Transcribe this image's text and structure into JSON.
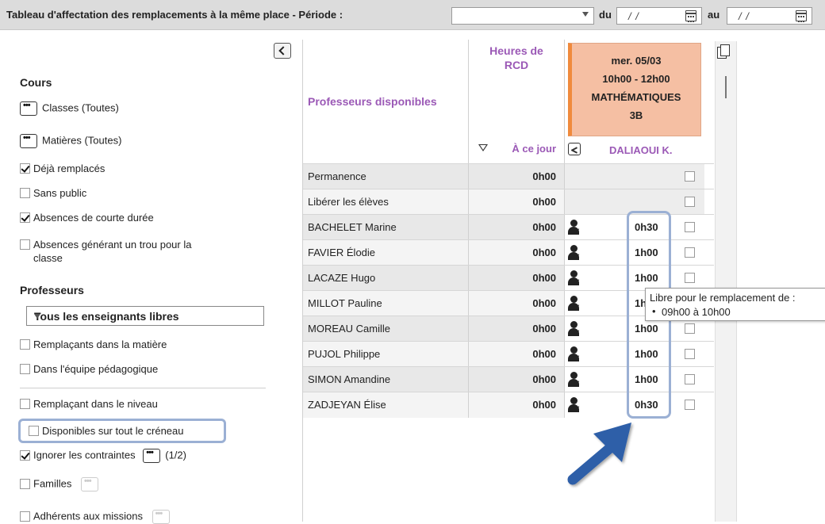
{
  "header": {
    "title": "Tableau d'affectation des remplacements à la même place  -  Période :",
    "period_value": "",
    "du_label": "du",
    "au_label": "au",
    "date_from": "/ /",
    "date_to": "/ /"
  },
  "filters": {
    "cours_title": "Cours",
    "classes_label": "Classes (Toutes)",
    "matieres_label": "Matières (Toutes)",
    "options": [
      {
        "label": "Déjà remplacés",
        "checked": true
      },
      {
        "label": "Sans public",
        "checked": false
      },
      {
        "label": "Absences de courte durée",
        "checked": true
      },
      {
        "label": "Absences générant un trou pour la",
        "label2": "classe",
        "checked": false
      }
    ],
    "professeurs_title": "Professeurs",
    "prof_select": "Tous les enseignants libres",
    "prof_options": [
      {
        "label": "Remplaçants dans la matière",
        "checked": false
      },
      {
        "label": "Dans l'équipe pédagogique",
        "checked": false
      },
      {
        "label": "Remplaçant dans le niveau",
        "checked": false
      },
      {
        "label": "Disponibles sur tout le créneau",
        "checked": false
      },
      {
        "label": "Ignorer les contraintes",
        "checked": true,
        "count": "(1/2)"
      },
      {
        "label": "Familles",
        "checked": false
      },
      {
        "label": "Adhérents aux missions",
        "checked": false
      }
    ]
  },
  "grid": {
    "col_prof": "Professeurs disponibles",
    "col_rcd_line1": "Heures de",
    "col_rcd_line2": "RCD",
    "col_rcd_sort": "À ce jour",
    "course": {
      "date": "mer. 05/03",
      "time": "10h00 - 12h00",
      "subject": "MATHÉMATIQUES",
      "class": "3B",
      "teacher": "DALIAOUI K."
    },
    "rows": [
      {
        "name": "Permanence",
        "rcd": "0h00",
        "slot": "",
        "icon": false
      },
      {
        "name": "Libérer les élèves",
        "rcd": "0h00",
        "slot": "",
        "icon": false
      },
      {
        "name": "BACHELET Marine",
        "rcd": "0h00",
        "slot": "0h30",
        "icon": true
      },
      {
        "name": "FAVIER Élodie",
        "rcd": "0h00",
        "slot": "1h00",
        "icon": true
      },
      {
        "name": "LACAZE Hugo",
        "rcd": "0h00",
        "slot": "1h00",
        "icon": true
      },
      {
        "name": "MILLOT Pauline",
        "rcd": "0h00",
        "slot": "1h",
        "icon": true
      },
      {
        "name": "MOREAU Camille",
        "rcd": "0h00",
        "slot": "1h00",
        "icon": true
      },
      {
        "name": "PUJOL Philippe",
        "rcd": "0h00",
        "slot": "1h00",
        "icon": true
      },
      {
        "name": "SIMON Amandine",
        "rcd": "0h00",
        "slot": "1h00",
        "icon": true
      },
      {
        "name": "ZADJEYAN Élise",
        "rcd": "0h00",
        "slot": "0h30",
        "icon": true
      }
    ]
  },
  "tooltip": {
    "line1": "Libre pour le remplacement de :",
    "line2": "09h00 à 10h00"
  },
  "colors": {
    "accent_purple": "#9b59b6",
    "course_bg": "#f5bfa3",
    "course_border": "#f08a3c",
    "highlight": "#9bb0d4",
    "arrow": "#2f5fa8"
  }
}
